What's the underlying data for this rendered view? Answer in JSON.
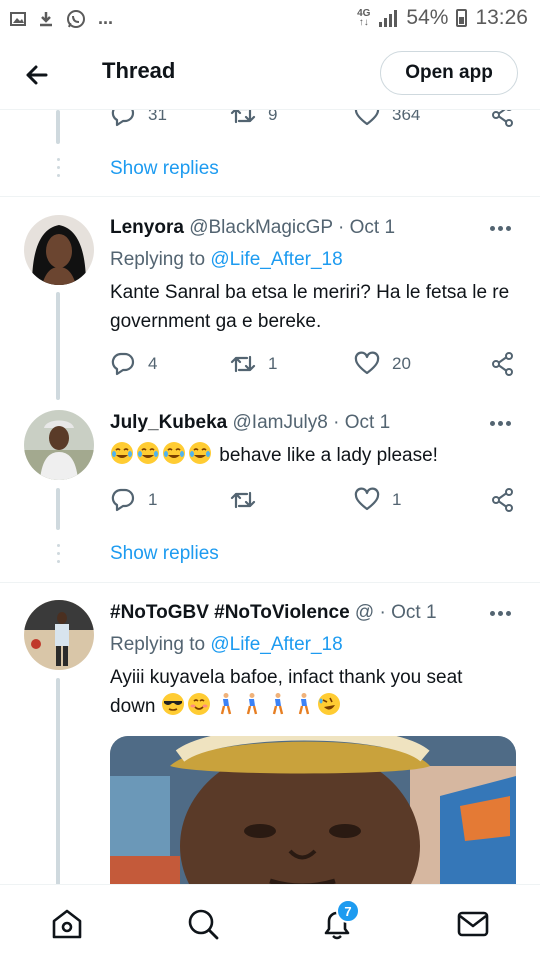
{
  "status_bar": {
    "network": "4G",
    "battery": "54%",
    "time": "13:26",
    "more": "..."
  },
  "header": {
    "title": "Thread",
    "open_app": "Open app"
  },
  "top_actions": {
    "replies": "31",
    "retweets": "9",
    "likes": "364"
  },
  "show_replies_1": "Show replies",
  "tweets": [
    {
      "name": "Lenyora",
      "handle": "@BlackMagicGP",
      "date": " · Oct 1",
      "replying_prefix": "Replying to ",
      "replying_to": "@Life_After_18",
      "text": "Kante Sanral ba etsa le meriri? Ha le fetsa le re government ga e bereke.",
      "replies": "4",
      "retweets": "1",
      "likes": "20"
    },
    {
      "name": "July_Kubeka",
      "handle": "@IamJuly8",
      "date": " · Oct 1",
      "text": "behave like a lady please!",
      "replies": "1",
      "retweets": "",
      "likes": "1"
    },
    {
      "name": "#NoToGBV #NoToViolence",
      "handle": " @",
      "date": " · Oct 1",
      "replying_prefix": "Replying to ",
      "replying_to": "@Life_After_18",
      "text_line1": "Ayiii kuyavela bafoe, infact thank you seat",
      "text_line2": "down"
    }
  ],
  "show_replies_2": "Show replies",
  "nav": {
    "notifications_badge": "7"
  },
  "colors": {
    "accent": "#1d9bf0",
    "text": "#0f1419",
    "secondary": "#536471",
    "divider": "#eff3f4"
  }
}
